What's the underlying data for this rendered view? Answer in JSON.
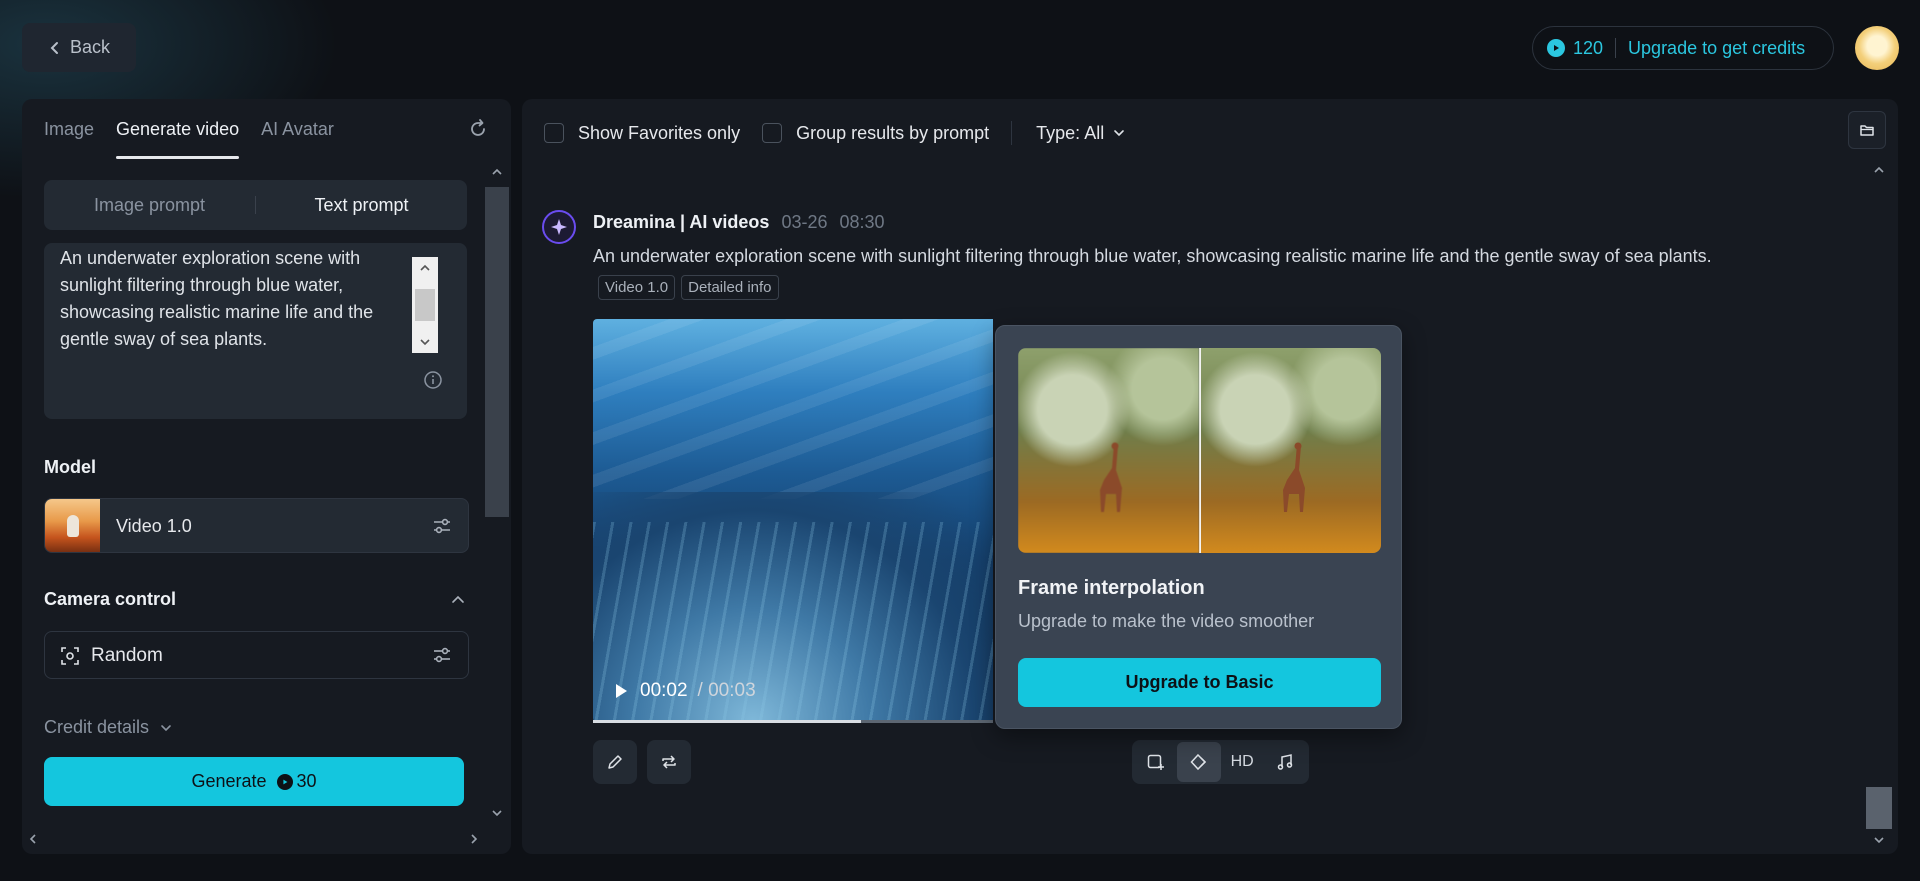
{
  "header": {
    "back_label": "Back",
    "credits": "120",
    "upgrade_label": "Upgrade to get credits"
  },
  "left": {
    "tabs": [
      {
        "label": "Image",
        "active": false
      },
      {
        "label": "Generate video",
        "active": true
      },
      {
        "label": "AI Avatar",
        "active": false
      }
    ],
    "prompt_modes": {
      "image": "Image prompt",
      "text": "Text prompt",
      "active": "text"
    },
    "prompt_text": "An underwater exploration scene with sunlight filtering through blue water, showcasing realistic marine life and the gentle sway of sea plants.",
    "model_label": "Model",
    "model_value": "Video 1.0",
    "camera_label": "Camera control",
    "camera_value": "Random",
    "credit_details_label": "Credit details",
    "generate_label": "Generate",
    "generate_cost": "30"
  },
  "filters": {
    "favorites_label": "Show Favorites only",
    "group_label": "Group results by prompt",
    "type_label": "Type: All"
  },
  "post": {
    "author": "Dreamina | AI videos",
    "date": "03-26",
    "time": "08:30",
    "prompt": "An underwater exploration scene with sunlight filtering through blue water, showcasing realistic marine life and the gentle sway of sea plants.",
    "tags": [
      "Video 1.0",
      "Detailed info"
    ],
    "current_time": "00:02",
    "duration": "00:03",
    "progress": 0.67,
    "hd_label": "HD"
  },
  "popover": {
    "title": "Frame interpolation",
    "subtitle": "Upgrade to make the video smoother",
    "button_label": "Upgrade to Basic"
  },
  "colors": {
    "accent": "#14c6de",
    "background": "#0e1116",
    "panel": "#161a21",
    "popover": "#3a4452"
  }
}
